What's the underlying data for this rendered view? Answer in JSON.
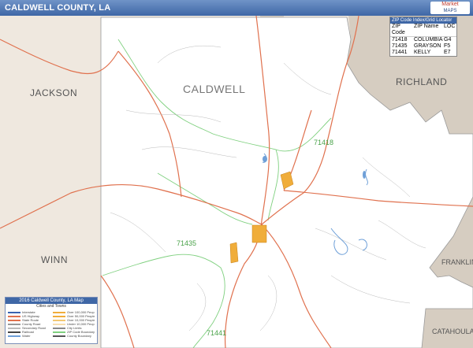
{
  "header": {
    "title": "CALDWELL COUNTY, LA",
    "brand_line1": "Market",
    "brand_line2": "MAPS"
  },
  "map": {
    "county_label": "CALDWELL",
    "neighbors": {
      "jackson": "JACKSON",
      "richland": "RICHLAND",
      "winn": "WINN",
      "franklin": "FRANKLIN",
      "catahoula": "CATAHOULA"
    },
    "zip_labels": [
      "71418",
      "71435",
      "71441"
    ],
    "colors": {
      "county_fill": "#ffffff",
      "outside_fill": "#efe8df",
      "neighbor_fill": "#d6cdc1",
      "road_major": "#e0714e",
      "zip_boundary": "#7fd07f",
      "water": "#6fa0d8",
      "city": "#f0ad3a"
    }
  },
  "zip_table": {
    "title": "ZIP Code Index/Grid Locator",
    "columns": [
      "ZIP Code",
      "ZIP Name",
      "LOC"
    ],
    "rows": [
      [
        "71418",
        "COLUMBIA",
        "G4"
      ],
      [
        "71435",
        "GRAYSON",
        "F5"
      ],
      [
        "71441",
        "KELLY",
        "E7"
      ]
    ]
  },
  "legend": {
    "title": "2016 Caldwell County, LA Map",
    "subtitle": "Cities and Towns",
    "items": [
      "Interstate",
      "Over 100,000 People",
      "US Highway",
      "Over 50,000 People",
      "State Route",
      "Over 10,000 People",
      "County Road",
      "Under 10,000 People",
      "Secondary Road",
      "City Limits",
      "Railroad",
      "ZIP Code Boundary",
      "Water",
      "County Boundary"
    ]
  }
}
